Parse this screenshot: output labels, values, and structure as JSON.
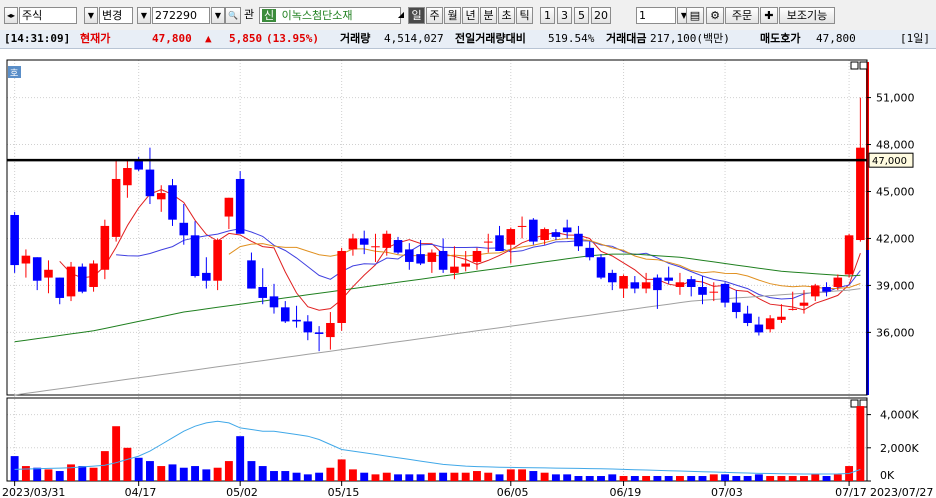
{
  "toolbar": {
    "market": "주식",
    "mode": "변경",
    "code": "272290",
    "search_label": "관",
    "new_badge": "신",
    "stock_name": "이녹스첨단소재",
    "periods": [
      "일",
      "주",
      "월",
      "년",
      "분",
      "초",
      "틱"
    ],
    "selected_period": "일",
    "intervals": [
      "1",
      "3",
      "5",
      "20"
    ],
    "count_value": "1",
    "order_label": "주문",
    "aux_label": "보조기능"
  },
  "quote": {
    "time": "[14:31:09]",
    "price_label": "현재가",
    "price": "47,800",
    "change_arrow": "▲",
    "change": "5,850",
    "change_pct": "(13.95%)",
    "volume_label": "거래량",
    "volume": "4,514,027",
    "vs_prev_label": "전일거래량대비",
    "vs_prev": "519.54%",
    "amount_label": "거래대금",
    "amount": "217,100(백만)",
    "ask_label": "매도호가",
    "ask": "47,800",
    "period_badge": "[1일]"
  },
  "colors": {
    "up": "#ff0000",
    "down": "#0000ff",
    "ma5": "#e02020",
    "ma10": "#4040e0",
    "ma20": "#e09020",
    "ma60": "#208020",
    "ma120": "#a0a0a0",
    "vol_ma": "#40a8e8"
  },
  "chart_data": {
    "type": "candlestick",
    "price_axis_labels": [
      "51,000",
      "48,000",
      "45,000",
      "42,000",
      "39,000",
      "36,000"
    ],
    "price_range": [
      32000,
      53400
    ],
    "horizontal_line": {
      "value": 47000,
      "label": "47,000"
    },
    "volume_axis_labels": [
      "4,000K",
      "2,000K",
      "0K"
    ],
    "volume_range": [
      0,
      5000
    ],
    "date_labels": [
      {
        "i": 0,
        "text": "2023/03/31"
      },
      {
        "i": 11,
        "text": "04/17"
      },
      {
        "i": 20,
        "text": "05/02"
      },
      {
        "i": 29,
        "text": "05/15"
      },
      {
        "i": 44,
        "text": "06/05"
      },
      {
        "i": 54,
        "text": "06/19"
      },
      {
        "i": 63,
        "text": "07/03"
      },
      {
        "i": 74,
        "text": "07/17"
      },
      {
        "i": 82,
        "text": "2023/07/27"
      }
    ],
    "candles": [
      [
        43500,
        43700,
        39800,
        40300,
        1500
      ],
      [
        40400,
        41300,
        39500,
        40900,
        900
      ],
      [
        40800,
        40800,
        38700,
        39300,
        800
      ],
      [
        39500,
        40600,
        38500,
        40000,
        700
      ],
      [
        39500,
        39500,
        37800,
        38200,
        600
      ],
      [
        38300,
        40500,
        38000,
        40200,
        1000
      ],
      [
        40200,
        40400,
        38500,
        38600,
        900
      ],
      [
        38900,
        40600,
        38600,
        40400,
        800
      ],
      [
        40000,
        43200,
        39400,
        42800,
        1800
      ],
      [
        42100,
        47000,
        41800,
        45800,
        3300
      ],
      [
        45400,
        47000,
        44600,
        46500,
        2000
      ],
      [
        47000,
        47200,
        46300,
        46400,
        1400
      ],
      [
        46400,
        47800,
        44200,
        44700,
        1200
      ],
      [
        44500,
        45400,
        43700,
        44900,
        900
      ],
      [
        45400,
        45800,
        42800,
        43200,
        1000
      ],
      [
        43000,
        44200,
        41600,
        42200,
        800
      ],
      [
        42200,
        43100,
        39500,
        39600,
        900
      ],
      [
        39800,
        40800,
        38800,
        39300,
        700
      ],
      [
        39300,
        42000,
        38700,
        41900,
        800
      ],
      [
        43400,
        44600,
        42600,
        44600,
        1200
      ],
      [
        45800,
        46300,
        42300,
        42300,
        2700
      ],
      [
        40600,
        41100,
        38800,
        38800,
        1200
      ],
      [
        38900,
        40100,
        37800,
        38200,
        900
      ],
      [
        38300,
        39100,
        37200,
        37600,
        600
      ],
      [
        37600,
        38000,
        36600,
        36700,
        600
      ],
      [
        36800,
        37700,
        36300,
        36700,
        500
      ],
      [
        36700,
        37100,
        35500,
        36000,
        400
      ],
      [
        36000,
        36400,
        34800,
        35900,
        500
      ],
      [
        35700,
        37300,
        34900,
        36600,
        800
      ],
      [
        36600,
        41400,
        36100,
        41200,
        1300
      ],
      [
        41300,
        42300,
        40900,
        42000,
        700
      ],
      [
        42000,
        42500,
        41000,
        41600,
        500
      ],
      [
        41500,
        42300,
        40500,
        41500,
        400
      ],
      [
        41400,
        42500,
        40900,
        42300,
        500
      ],
      [
        41900,
        42100,
        41000,
        41100,
        400
      ],
      [
        41300,
        41700,
        40000,
        40500,
        400
      ],
      [
        41000,
        41900,
        40300,
        40400,
        400
      ],
      [
        40500,
        41300,
        39800,
        41100,
        500
      ],
      [
        41200,
        42000,
        39800,
        40000,
        500
      ],
      [
        39800,
        41500,
        39400,
        40200,
        500
      ],
      [
        40200,
        41200,
        39900,
        40400,
        500
      ],
      [
        40500,
        41400,
        40000,
        41200,
        600
      ],
      [
        41800,
        42300,
        41100,
        41800,
        500
      ],
      [
        42200,
        42800,
        41200,
        41200,
        400
      ],
      [
        41600,
        42700,
        40400,
        42600,
        700
      ],
      [
        42800,
        43400,
        42000,
        42800,
        700
      ],
      [
        43200,
        43300,
        41600,
        41800,
        600
      ],
      [
        41900,
        42700,
        41600,
        42600,
        500
      ],
      [
        42400,
        42600,
        41900,
        42100,
        400
      ],
      [
        42700,
        43200,
        42000,
        42400,
        400
      ],
      [
        42300,
        42800,
        41200,
        41500,
        300
      ],
      [
        41400,
        41800,
        40600,
        40800,
        300
      ],
      [
        40800,
        41000,
        39400,
        39500,
        300
      ],
      [
        39800,
        40000,
        38700,
        39200,
        400
      ],
      [
        38800,
        39700,
        38200,
        39600,
        300
      ],
      [
        39200,
        39600,
        38500,
        38800,
        300
      ],
      [
        38800,
        39800,
        38500,
        39200,
        300
      ],
      [
        39500,
        39700,
        37500,
        38700,
        300
      ],
      [
        39500,
        40200,
        39100,
        39300,
        300
      ],
      [
        38900,
        39800,
        38400,
        39200,
        300
      ],
      [
        39400,
        39600,
        38300,
        38900,
        300
      ],
      [
        38900,
        39600,
        37800,
        38400,
        300
      ],
      [
        38600,
        39200,
        38000,
        38600,
        400
      ],
      [
        39100,
        39200,
        37600,
        37900,
        400
      ],
      [
        37900,
        38700,
        36900,
        37300,
        300
      ],
      [
        37200,
        37700,
        36400,
        36600,
        300
      ],
      [
        36500,
        37000,
        35800,
        36000,
        400
      ],
      [
        36200,
        37100,
        36000,
        36900,
        300
      ],
      [
        36800,
        37800,
        36600,
        37000,
        300
      ],
      [
        37500,
        38600,
        37400,
        37500,
        300
      ],
      [
        37700,
        38700,
        37200,
        37900,
        300
      ],
      [
        38300,
        39100,
        38000,
        39000,
        400
      ],
      [
        38900,
        39200,
        38300,
        38600,
        300
      ],
      [
        38900,
        39700,
        38700,
        39500,
        400
      ],
      [
        39700,
        42300,
        39500,
        42200,
        900
      ],
      [
        41900,
        51000,
        41800,
        47800,
        4514
      ]
    ],
    "series": [
      {
        "name": "MA5",
        "values": [
          null,
          null,
          null,
          null,
          40540,
          39760,
          39480,
          39580,
          40240,
          41440,
          42820,
          43960,
          44840,
          45120,
          44800,
          44300,
          43160,
          42260,
          41840,
          42320,
          42220,
          41820,
          41480,
          41400,
          39860,
          38520,
          37640,
          37420,
          37520,
          38100,
          38920,
          39660,
          40320,
          41400,
          41720,
          41920,
          41680,
          41660,
          41000,
          40860,
          40660,
          40340,
          40600,
          40920,
          41280,
          41720,
          42000,
          42240,
          42380,
          42220,
          42200,
          42000,
          41180,
          40880,
          40440,
          40000,
          39400,
          39380,
          39080,
          38960,
          39300,
          39220,
          38940,
          39000,
          38680,
          38620,
          38160,
          37800,
          37720,
          37620,
          37440,
          37860,
          38100,
          38360,
          39060,
          41060
        ]
      },
      {
        "name": "MA10",
        "values": [
          null,
          null,
          null,
          null,
          null,
          null,
          null,
          null,
          null,
          40960,
          40900,
          40880,
          41040,
          41270,
          41480,
          41880,
          42050,
          42170,
          42280,
          42480,
          42630,
          42410,
          42130,
          41560,
          41230,
          40760,
          40200,
          39640,
          39390,
          39880,
          40250,
          40380,
          40360,
          40750,
          40690,
          41160,
          41590,
          41620,
          41440,
          41420,
          41420,
          41440,
          41380,
          41400,
          41140,
          41210,
          41450,
          41570,
          41780,
          41800,
          41850,
          41840,
          41590,
          41500,
          41160,
          40970,
          41060,
          40760,
          40410,
          40180,
          39880,
          39600,
          39380,
          39260,
          39020,
          38800,
          38420,
          38220,
          38130,
          38170,
          38460,
          38560,
          38560,
          38860,
          39020,
          39950
        ]
      },
      {
        "name": "MA20",
        "values": [
          null,
          null,
          null,
          null,
          null,
          null,
          null,
          null,
          null,
          null,
          null,
          null,
          null,
          null,
          null,
          null,
          null,
          null,
          null,
          40990,
          41480,
          41640,
          41670,
          41510,
          41430,
          41430,
          41190,
          40960,
          40860,
          41010,
          41330,
          41330,
          41180,
          41120,
          40960,
          40890,
          40910,
          40950,
          40860,
          40940,
          40880,
          40950,
          41060,
          41080,
          41320,
          41460,
          41570,
          41730,
          41920,
          42000,
          41960,
          41870,
          41640,
          41400,
          41240,
          40880,
          40680,
          40640,
          40480,
          40280,
          39960,
          39810,
          39870,
          39770,
          39760,
          39600,
          39340,
          39110,
          38980,
          38910,
          38960,
          38890,
          38800,
          38810,
          38870,
          39120
        ]
      },
      {
        "name": "MA60",
        "values": [
          35400,
          35500,
          35600,
          35700,
          35800,
          35900,
          36000,
          36100,
          36250,
          36400,
          36550,
          36700,
          36850,
          37000,
          37150,
          37300,
          37400,
          37500,
          37600,
          37700,
          37800,
          37900,
          38000,
          38100,
          38200,
          38300,
          38400,
          38500,
          38600,
          38700,
          38800,
          38900,
          39000,
          39100,
          39200,
          39300,
          39400,
          39500,
          39600,
          39700,
          39800,
          39900,
          40000,
          40100,
          40200,
          40300,
          40400,
          40500,
          40600,
          40700,
          40800,
          40900,
          40950,
          41000,
          41000,
          41000,
          40950,
          40900,
          40850,
          40800,
          40700,
          40600,
          40500,
          40400,
          40300,
          40200,
          40100,
          40000,
          39900,
          39850,
          39800,
          39750,
          39700,
          39650,
          39600,
          39650
        ]
      },
      {
        "name": "MA120",
        "values": [
          32000,
          32100,
          32200,
          32300,
          32400,
          32500,
          32600,
          32700,
          32800,
          32900,
          33000,
          33100,
          33200,
          33300,
          33400,
          33500,
          33600,
          33700,
          33800,
          33900,
          34000,
          34100,
          34200,
          34300,
          34400,
          34500,
          34600,
          34700,
          34800,
          34900,
          35000,
          35100,
          35200,
          35300,
          35400,
          35500,
          35600,
          35700,
          35800,
          35900,
          36000,
          36100,
          36200,
          36300,
          36400,
          36500,
          36600,
          36700,
          36800,
          36900,
          37000,
          37100,
          37200,
          37300,
          37400,
          37500,
          37600,
          37700,
          37800,
          37900,
          38000,
          38050,
          38100,
          38150,
          38200,
          38250,
          38300,
          38350,
          38400,
          38450,
          38500,
          38550,
          38600,
          38650,
          38700,
          38800
        ]
      },
      {
        "name": "VolMA",
        "values": [
          700,
          720,
          740,
          760,
          780,
          800,
          850,
          900,
          950,
          1100,
          1300,
          1500,
          1800,
          2200,
          2600,
          3000,
          3300,
          3500,
          3600,
          3500,
          3200,
          3100,
          3000,
          3000,
          2900,
          2800,
          2700,
          2500,
          2200,
          1900,
          1800,
          1700,
          1600,
          1500,
          1400,
          1300,
          1200,
          1100,
          1000,
          950,
          900,
          870,
          850,
          830,
          820,
          810,
          800,
          790,
          780,
          770,
          760,
          750,
          740,
          720,
          700,
          680,
          660,
          640,
          620,
          600,
          580,
          560,
          540,
          520,
          500,
          480,
          460,
          450,
          440,
          430,
          420,
          420,
          420,
          430,
          450,
          700
        ]
      }
    ]
  }
}
